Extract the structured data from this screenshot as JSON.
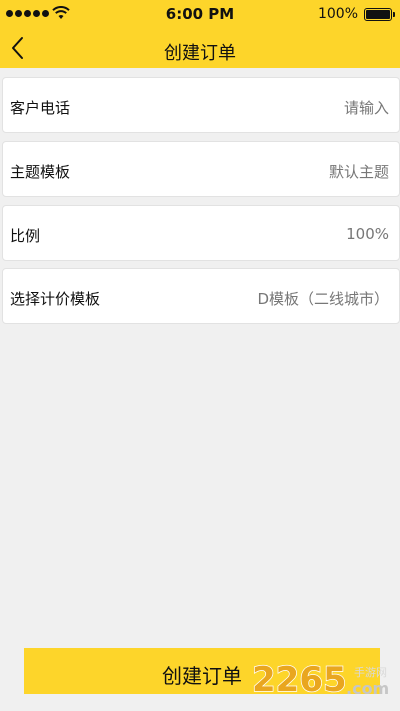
{
  "status_bar": {
    "time": "6:00 PM",
    "battery_percent": "100%"
  },
  "nav": {
    "title": "创建订单"
  },
  "form": {
    "rows": [
      {
        "label": "客户电话",
        "value": "请输入"
      },
      {
        "label": "主题模板",
        "value": "默认主题"
      },
      {
        "label": "比例",
        "value": "100%"
      },
      {
        "label": "选择计价模板",
        "value": "D模板（二线城市）"
      }
    ]
  },
  "actions": {
    "submit_label": "创建订单"
  },
  "watermark": {
    "brand": "2265",
    "domain": ".com",
    "tagline": "手游网"
  },
  "colors": {
    "accent": "#fdd52a",
    "background": "#f0f0f0"
  }
}
